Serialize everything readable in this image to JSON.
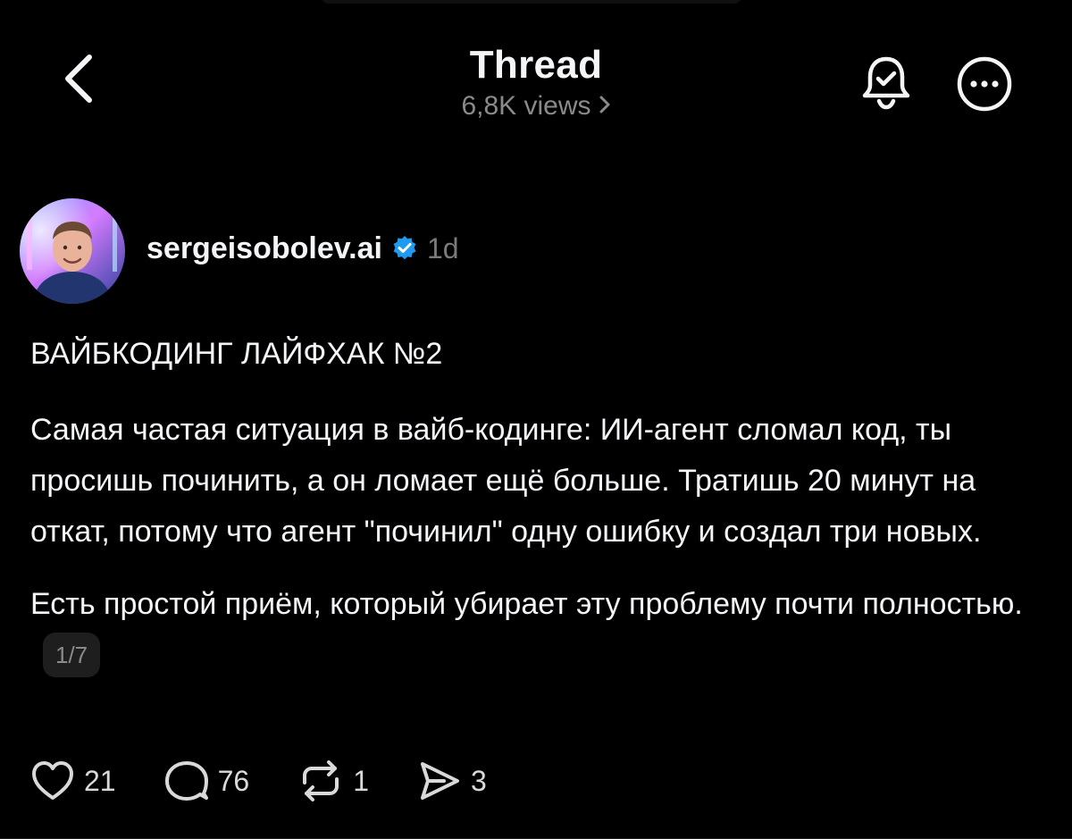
{
  "header": {
    "title": "Thread",
    "views": "6,8K views"
  },
  "post": {
    "author": "sergeisobolev.ai",
    "time": "1d",
    "title": "ВАЙБКОДИНГ ЛАЙФХАК №2",
    "paragraph1": "Самая частая ситуация в вайб-кодинге: ИИ-агент сломал код, ты просишь починить, а он ломает ещё больше. Тратишь 20 минут на откат, потому что агент \"починил\" одну ошибку и создал три новых.",
    "paragraph2": "Есть простой приём, который убирает эту проблему почти полностью.",
    "page_indicator": "1/7"
  },
  "actions": {
    "likes": "21",
    "comments": "76",
    "reposts": "1",
    "shares": "3"
  },
  "icons": {
    "back": "chevron-left-icon",
    "bell": "bell-check-icon",
    "more": "more-circle-icon",
    "verified": "verified-badge-icon",
    "like": "heart-icon",
    "comment": "comment-icon",
    "repost": "repost-icon",
    "share": "send-icon"
  },
  "colors": {
    "background": "#000000",
    "text": "#f3f5f7",
    "muted": "#8a8a8a",
    "verified": "#1d9bf0"
  }
}
